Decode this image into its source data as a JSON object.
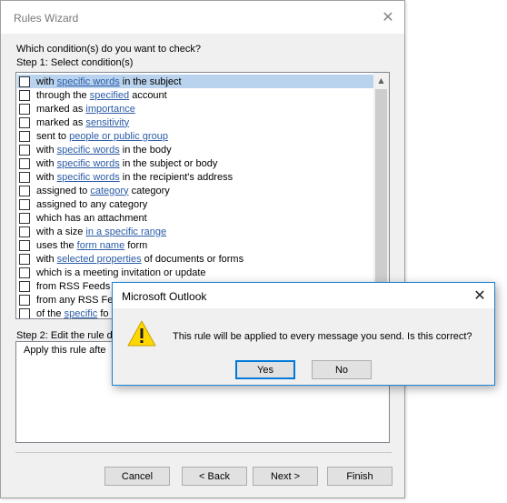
{
  "wizard": {
    "title": "Rules Wizard",
    "close_glyph": "✕",
    "question": "Which condition(s) do you want to check?",
    "step1": "Step 1: Select condition(s)",
    "step2": "Step 2: Edit the rule d",
    "description": "Apply this rule afte",
    "conditions": [
      {
        "parts": [
          {
            "t": "with "
          },
          {
            "t": "specific words",
            "link": true
          },
          {
            "t": " in the subject"
          }
        ],
        "checked": false,
        "selected": true
      },
      {
        "parts": [
          {
            "t": "through the "
          },
          {
            "t": "specified",
            "link": true
          },
          {
            "t": " account"
          }
        ],
        "checked": false
      },
      {
        "parts": [
          {
            "t": "marked as "
          },
          {
            "t": "importance",
            "link": true
          }
        ],
        "checked": false
      },
      {
        "parts": [
          {
            "t": "marked as "
          },
          {
            "t": "sensitivity",
            "link": true
          }
        ],
        "checked": false
      },
      {
        "parts": [
          {
            "t": "sent to "
          },
          {
            "t": "people or public group",
            "link": true
          }
        ],
        "checked": false
      },
      {
        "parts": [
          {
            "t": "with "
          },
          {
            "t": "specific words",
            "link": true
          },
          {
            "t": " in the body"
          }
        ],
        "checked": false
      },
      {
        "parts": [
          {
            "t": "with "
          },
          {
            "t": "specific words",
            "link": true
          },
          {
            "t": " in the subject or body"
          }
        ],
        "checked": false
      },
      {
        "parts": [
          {
            "t": "with "
          },
          {
            "t": "specific words",
            "link": true
          },
          {
            "t": " in the recipient's address"
          }
        ],
        "checked": false
      },
      {
        "parts": [
          {
            "t": "assigned to "
          },
          {
            "t": "category",
            "link": true
          },
          {
            "t": " category"
          }
        ],
        "checked": false
      },
      {
        "parts": [
          {
            "t": "assigned to any category"
          }
        ],
        "checked": false
      },
      {
        "parts": [
          {
            "t": "which has an attachment"
          }
        ],
        "checked": false
      },
      {
        "parts": [
          {
            "t": "with a size "
          },
          {
            "t": "in a specific range",
            "link": true
          }
        ],
        "checked": false
      },
      {
        "parts": [
          {
            "t": "uses the "
          },
          {
            "t": "form name",
            "link": true
          },
          {
            "t": " form"
          }
        ],
        "checked": false
      },
      {
        "parts": [
          {
            "t": "with "
          },
          {
            "t": "selected properties",
            "link": true
          },
          {
            "t": " of documents or forms"
          }
        ],
        "checked": false
      },
      {
        "parts": [
          {
            "t": "which is a meeting invitation or update"
          }
        ],
        "checked": false
      },
      {
        "parts": [
          {
            "t": "from RSS Feeds v"
          }
        ],
        "checked": false
      },
      {
        "parts": [
          {
            "t": "from any RSS Feed"
          }
        ],
        "checked": false
      },
      {
        "parts": [
          {
            "t": "of the "
          },
          {
            "t": "specific",
            "link": true
          },
          {
            "t": " fo"
          }
        ],
        "checked": false
      }
    ],
    "buttons": {
      "cancel": "Cancel",
      "back": "< Back",
      "next": "Next >",
      "finish": "Finish"
    }
  },
  "dialog": {
    "title": "Microsoft Outlook",
    "close_glyph": "✕",
    "icon": "warning-icon",
    "message": "This rule will be applied to every message you send. Is this correct?",
    "yes": "Yes",
    "no": "No",
    "colors": {
      "border": "#1883d7",
      "warning_fill": "#ffd700"
    }
  }
}
